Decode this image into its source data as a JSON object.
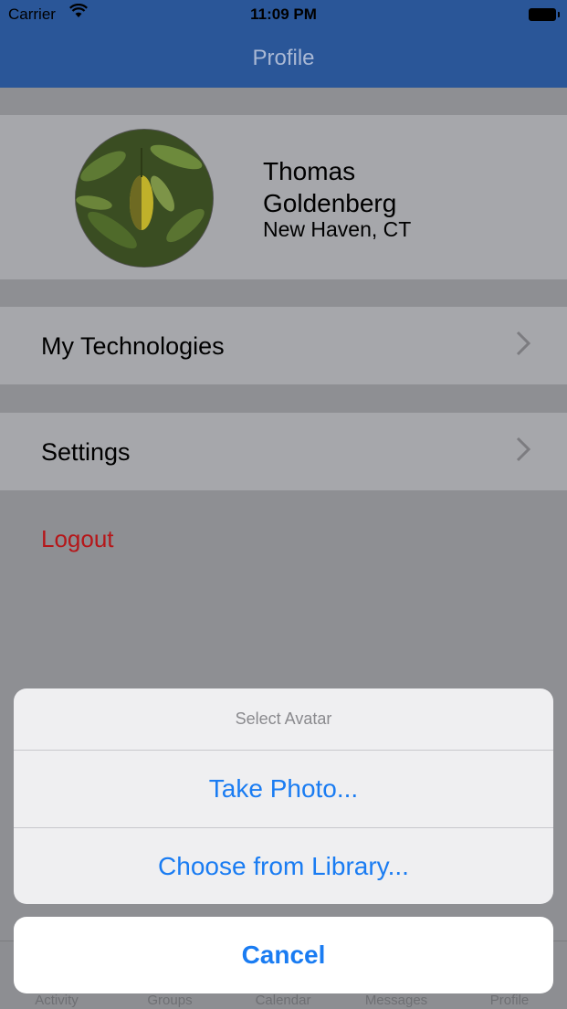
{
  "status_bar": {
    "carrier": "Carrier",
    "time": "11:09 PM"
  },
  "nav": {
    "title": "Profile"
  },
  "profile": {
    "name": "Thomas Goldenberg",
    "location": "New Haven, CT"
  },
  "menu": [
    {
      "label": "My Technologies"
    },
    {
      "label": "Settings"
    }
  ],
  "logout_label": "Logout",
  "tabs": [
    "Activity",
    "Groups",
    "Calendar",
    "Messages",
    "Profile"
  ],
  "action_sheet": {
    "title": "Select Avatar",
    "options": [
      "Take Photo...",
      "Choose from Library..."
    ],
    "cancel": "Cancel"
  },
  "colors": {
    "nav_bar": "#2a5698",
    "action_blue": "#1a7cf2",
    "logout_red": "#b5171a"
  }
}
